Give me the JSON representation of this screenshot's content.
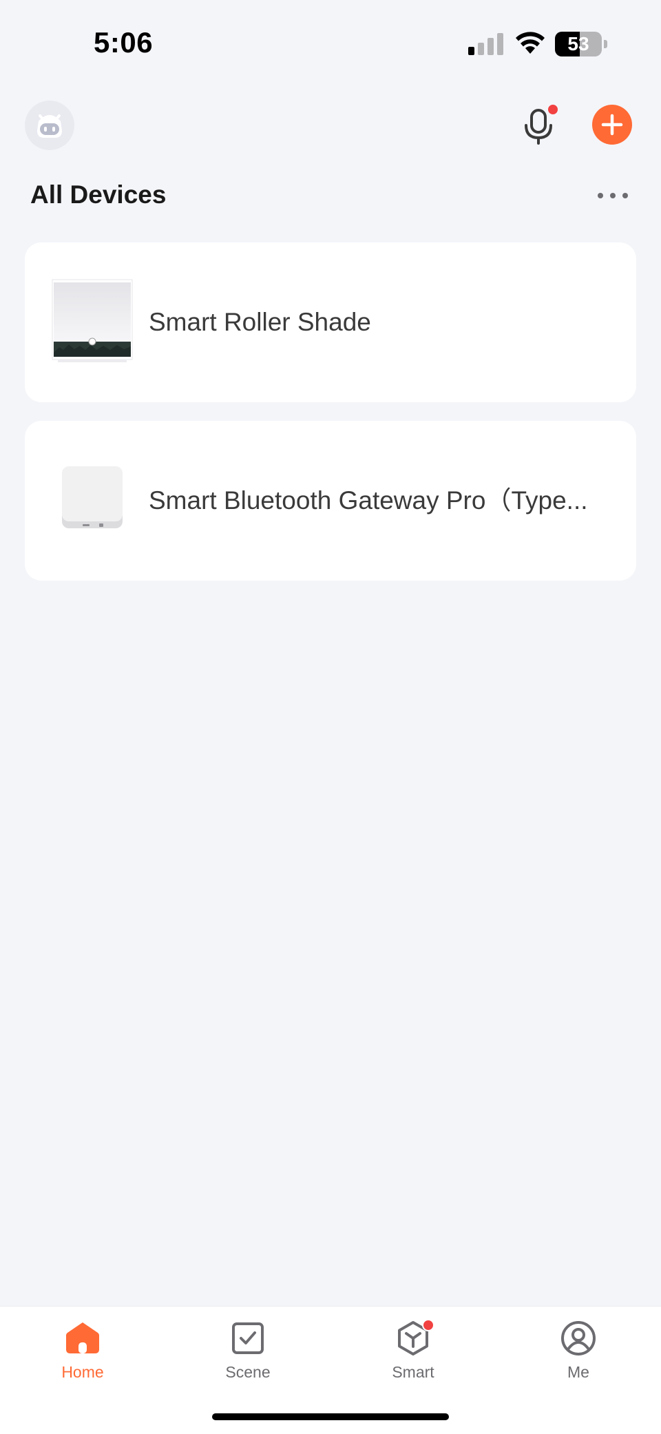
{
  "status_bar": {
    "time": "5:06",
    "battery_level": "53",
    "battery_percent": 53
  },
  "header": {
    "avatar_icon": "robot-avatar-icon",
    "mic_icon": "microphone-icon",
    "add_icon": "plus-icon",
    "more_icon": "ellipsis-icon"
  },
  "page": {
    "title": "All Devices"
  },
  "devices": [
    {
      "name": "Smart Roller Shade",
      "icon": "roller-shade-thumbnail"
    },
    {
      "name": "Smart Bluetooth Gateway Pro（Type...",
      "icon": "gateway-thumbnail"
    }
  ],
  "tab_bar": {
    "tabs": [
      {
        "label": "Home",
        "icon": "home-icon",
        "active": true
      },
      {
        "label": "Scene",
        "icon": "scene-checkbox-icon",
        "active": false
      },
      {
        "label": "Smart",
        "icon": "smart-cube-icon",
        "active": false
      },
      {
        "label": "Me",
        "icon": "profile-icon",
        "active": false
      }
    ]
  },
  "colors": {
    "accent": "#ff6a35",
    "background": "#f4f5f9",
    "badge": "#f24141"
  }
}
